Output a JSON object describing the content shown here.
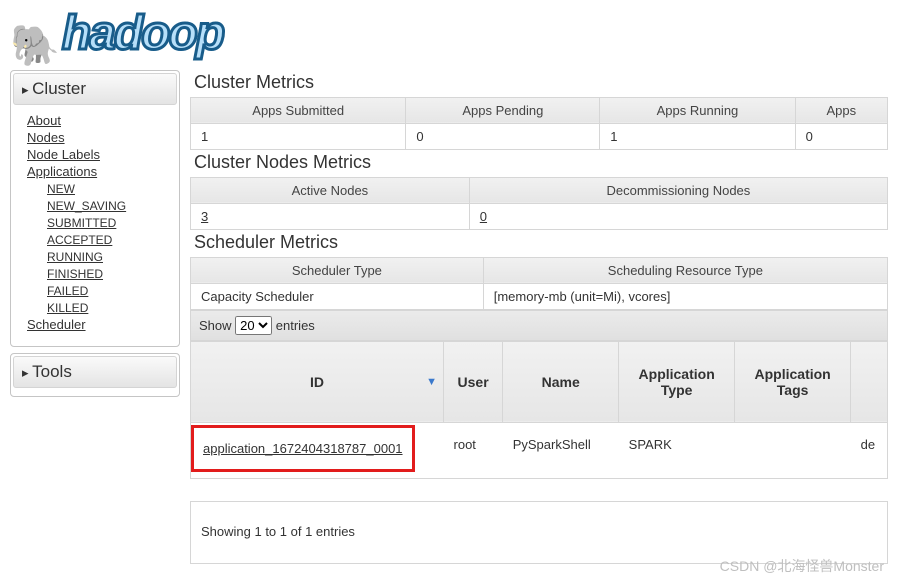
{
  "logo": {
    "text": "hadoop"
  },
  "sidebar": {
    "cluster": {
      "header": "Cluster",
      "links": {
        "about": "About",
        "nodes": "Nodes",
        "node_labels": "Node Labels",
        "applications": "Applications",
        "scheduler": "Scheduler"
      },
      "app_states": [
        "NEW",
        "NEW_SAVING",
        "SUBMITTED",
        "ACCEPTED",
        "RUNNING",
        "FINISHED",
        "FAILED",
        "KILLED"
      ]
    },
    "tools": {
      "header": "Tools"
    }
  },
  "cluster_metrics": {
    "title": "Cluster Metrics",
    "headers": [
      "Apps Submitted",
      "Apps Pending",
      "Apps Running",
      "Apps"
    ],
    "values": [
      "1",
      "0",
      "1",
      "0"
    ]
  },
  "node_metrics": {
    "title": "Cluster Nodes Metrics",
    "headers": [
      "Active Nodes",
      "Decommissioning Nodes"
    ],
    "values": [
      "3",
      "0"
    ]
  },
  "scheduler_metrics": {
    "title": "Scheduler Metrics",
    "headers": [
      "Scheduler Type",
      "Scheduling Resource Type"
    ],
    "values": [
      "Capacity Scheduler",
      "[memory-mb (unit=Mi), vcores]"
    ]
  },
  "datatable": {
    "show_prefix": "Show",
    "show_suffix": "entries",
    "page_size": "20",
    "columns": [
      "ID",
      "User",
      "Name",
      "Application Type",
      "Application Tags",
      ""
    ],
    "row": {
      "id": "application_1672404318787_0001",
      "user": "root",
      "name": "PySparkShell",
      "app_type": "SPARK",
      "app_tags": "",
      "extra": "de"
    },
    "info": "Showing 1 to 1 of 1 entries"
  },
  "watermark": "CSDN @北海怪兽Monster"
}
